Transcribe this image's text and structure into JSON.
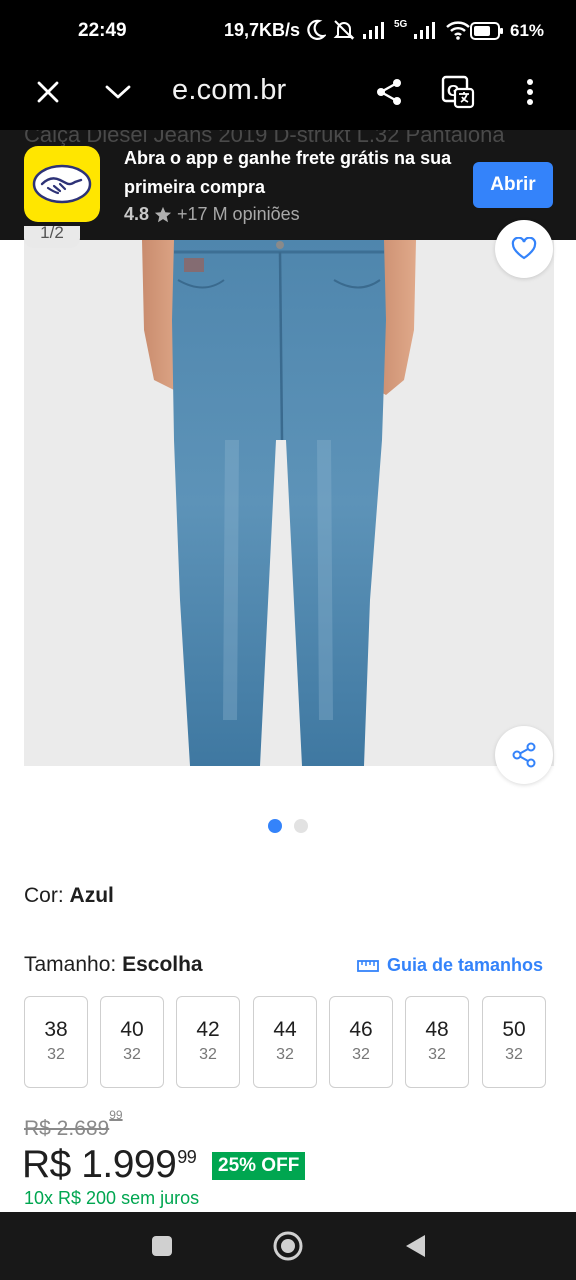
{
  "status_bar": {
    "time": "22:49",
    "data_rate": "19,7KB/s",
    "network": "5G",
    "battery": "61%"
  },
  "browser": {
    "url": "e.com.br"
  },
  "app_banner": {
    "ghost_title": "Calça Diesel Jeans 2019 D-strukt L.32 Pantalona",
    "message": "Abra o app e ganhe frete grátis na sua primeira compra",
    "rating": "4.8",
    "reviews": "+17 M opiniões",
    "open_label": "Abrir"
  },
  "gallery": {
    "counter": "1/2",
    "total_images": 2,
    "current_image": 1
  },
  "product": {
    "color_label": "Cor:",
    "color_value": "Azul",
    "size_label": "Tamanho:",
    "size_value": "Escolha",
    "size_guide": "Guia de tamanhos",
    "sizes": [
      {
        "waist": "38",
        "length": "32"
      },
      {
        "waist": "40",
        "length": "32"
      },
      {
        "waist": "42",
        "length": "32"
      },
      {
        "waist": "44",
        "length": "32"
      },
      {
        "waist": "46",
        "length": "32"
      },
      {
        "waist": "48",
        "length": "32"
      },
      {
        "waist": "50",
        "length": "32"
      }
    ],
    "old_price": "R$ 2.689",
    "old_price_cents": "99",
    "price": "R$ 1.999",
    "price_cents": "99",
    "discount": "25% OFF",
    "installments": "10x R$ 200 sem juros"
  },
  "colors": {
    "accent": "#3483fa",
    "brand_yellow": "#ffe600",
    "green": "#00a650"
  }
}
